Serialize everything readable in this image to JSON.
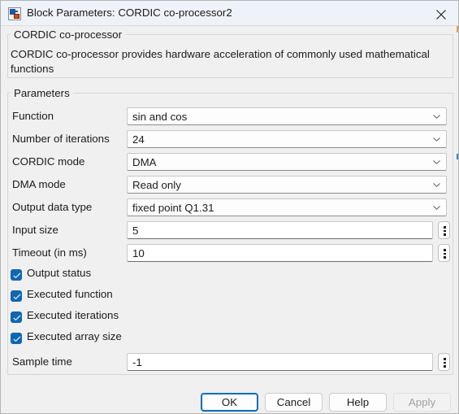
{
  "window": {
    "title": "Block Parameters: CORDIC co-processor2",
    "icon": "simulink-block-icon",
    "close_label": "✕"
  },
  "description": {
    "group_label": "CORDIC co-processor",
    "text": "CORDIC co-processor provides hardware acceleration of commonly used mathematical functions"
  },
  "parameters": {
    "group_label": "Parameters",
    "combos": [
      {
        "label": "Function",
        "value": "sin and cos"
      },
      {
        "label": "Number of iterations",
        "value": "24"
      },
      {
        "label": "CORDIC mode",
        "value": "DMA"
      },
      {
        "label": "DMA mode",
        "value": "Read only"
      },
      {
        "label": "Output data type",
        "value": "fixed point Q1.31"
      }
    ],
    "fields": [
      {
        "label": "Input size",
        "value": "5"
      },
      {
        "label": "Timeout (in ms)",
        "value": "10"
      }
    ],
    "checkboxes": [
      {
        "label": "Output status",
        "checked": true
      },
      {
        "label": "Executed function",
        "checked": true
      },
      {
        "label": "Executed iterations",
        "checked": true
      },
      {
        "label": "Executed array size",
        "checked": true
      }
    ],
    "sample_time": {
      "label": "Sample time",
      "value": "-1"
    }
  },
  "buttons": {
    "ok": "OK",
    "cancel": "Cancel",
    "help": "Help",
    "apply": "Apply"
  },
  "colors": {
    "titlebar": "#eef3f9",
    "dialog_bg": "#f0f0f0",
    "checkbox_blue": "#0f67b1",
    "focus_blue": "#0f6cbd",
    "disabled_text": "#a0a0a0"
  }
}
